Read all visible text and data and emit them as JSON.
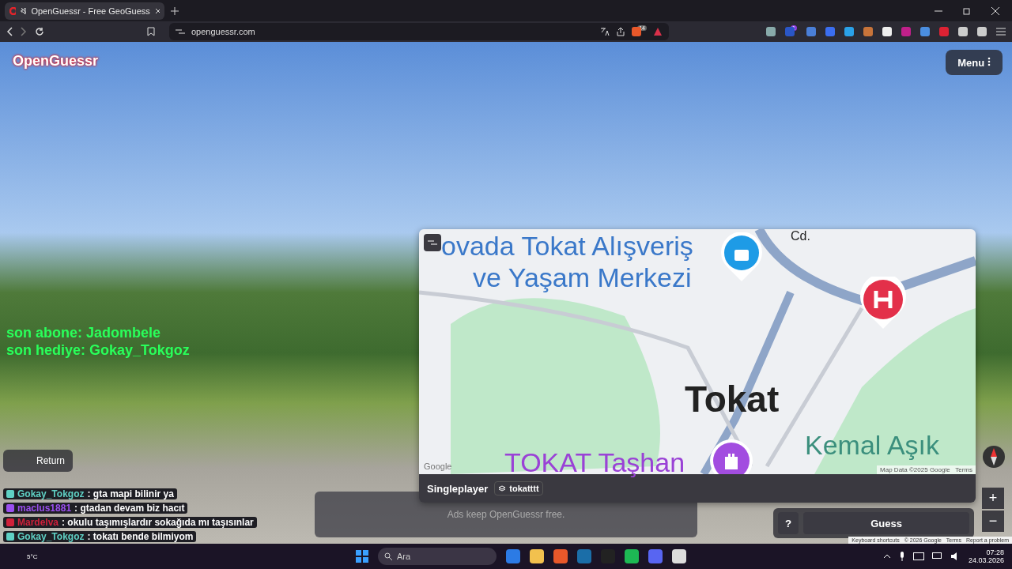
{
  "browser": {
    "tab": {
      "title": "OpenGuessr - Free GeoGuess",
      "selected": true
    },
    "url": "openguessr.com",
    "shield_count": "14",
    "extension_badge": "1"
  },
  "page": {
    "logo": "OpenGuessr",
    "menu": "Menu",
    "overlay_lines": [
      "son abone: Jadombele",
      "son hediye: Gokay_Tokgoz"
    ],
    "chat": [
      {
        "user": "Gokay_Tokgoz",
        "color": "#5fd0c4",
        "message": ": gta mapi bilinir ya"
      },
      {
        "user": "maclus1881",
        "color": "#9b4ff0",
        "message": ": gtadan devam biz hacıt"
      },
      {
        "user": "Mardelva",
        "color": "#d0203a",
        "message": ": okulu taşımışlardır sokağıda mı taşısınlar"
      },
      {
        "user": "Gokay_Tokgoz",
        "color": "#5fd0c4",
        "message": ": tokatı bende bilmiyom"
      }
    ],
    "return": "Return",
    "map": {
      "labels": [
        {
          "kind": "poi",
          "text": "ovada Tokat Alışveriş"
        },
        {
          "kind": "poi",
          "text": "ve Yaşam Merkezi"
        },
        {
          "kind": "street",
          "text": "Cd."
        },
        {
          "kind": "city",
          "text": "Tokat"
        },
        {
          "kind": "landmark",
          "text": "TOKAT Taşhan"
        },
        {
          "kind": "park",
          "text": "Kemal Aşık"
        }
      ],
      "google": "Google",
      "map_data": "Map Data ©2025 Google",
      "terms": "Terms",
      "mode": "Singleplayer",
      "map_name": "tokatttt"
    },
    "ad": "Ads keep OpenGuessr free.",
    "help": "?",
    "guess": "Guess",
    "zoom_in": "+",
    "zoom_out": "−",
    "attribution": [
      "Keyboard shortcuts",
      "© 2026 Google",
      "Terms",
      "Report a problem"
    ]
  },
  "taskbar": {
    "search": "Ara",
    "weather": "5°C",
    "time": "07:28",
    "date": "24.03.2026"
  }
}
